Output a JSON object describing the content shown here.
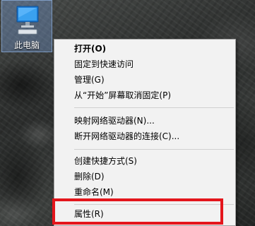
{
  "desktop": {
    "icon": {
      "label": "此电脑",
      "icon_name": "this-pc-icon"
    }
  },
  "context_menu": {
    "items": [
      {
        "label": "打开(O)",
        "bold": true
      },
      {
        "label": "固定到快速访问"
      },
      {
        "label": "管理(G)"
      },
      {
        "label": "从“开始”屏幕取消固定(P)"
      },
      {
        "label": "映射网络驱动器(N)..."
      },
      {
        "label": "断开网络驱动器的连接(C)..."
      },
      {
        "label": "创建快捷方式(S)"
      },
      {
        "label": "删除(D)"
      },
      {
        "label": "重命名(M)"
      },
      {
        "label": "属性(R)"
      }
    ]
  },
  "colors": {
    "highlight_border": "#e4161c",
    "menu_background": "#f2f2f2"
  }
}
